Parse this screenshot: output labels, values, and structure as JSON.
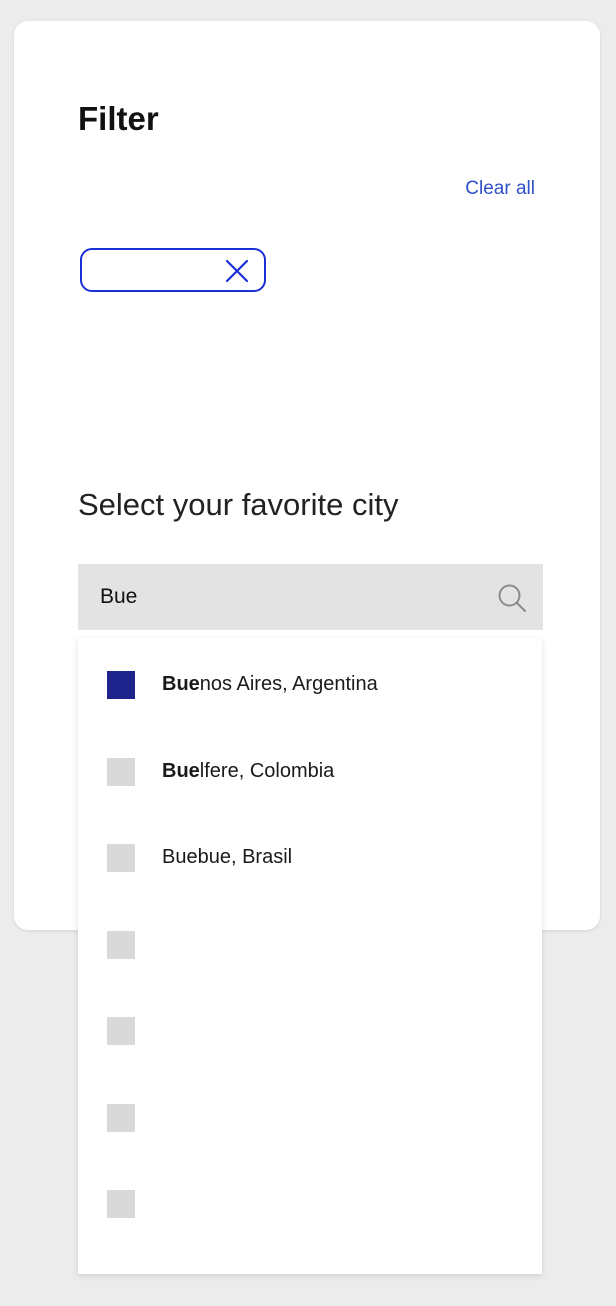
{
  "filter": {
    "title": "Filter",
    "clear_all_label": "Clear all",
    "chip": {
      "label": "",
      "close_icon": "close-icon"
    }
  },
  "city_select": {
    "title": "Select your favorite city",
    "search": {
      "value": "Bue",
      "placeholder": "",
      "icon": "search-icon"
    },
    "options": [
      {
        "match": "Bue",
        "rest": "nos Aires, Argentina",
        "checked": true
      },
      {
        "match": "Bue",
        "rest": "lfere, Colombia",
        "checked": false
      },
      {
        "match": "",
        "rest": "Buebue, Brasil",
        "checked": false
      },
      {
        "match": "",
        "rest": "",
        "checked": false
      },
      {
        "match": "",
        "rest": "",
        "checked": false
      },
      {
        "match": "",
        "rest": "",
        "checked": false
      },
      {
        "match": "",
        "rest": "",
        "checked": false
      }
    ]
  },
  "colors": {
    "accent": "#1a2fd6",
    "link": "#2f4fc8",
    "checkbox_checked": "#1e238c",
    "checkbox_unchecked": "#d9d9d9",
    "search_bg": "#e3e3e3",
    "page_bg": "#ececec"
  }
}
